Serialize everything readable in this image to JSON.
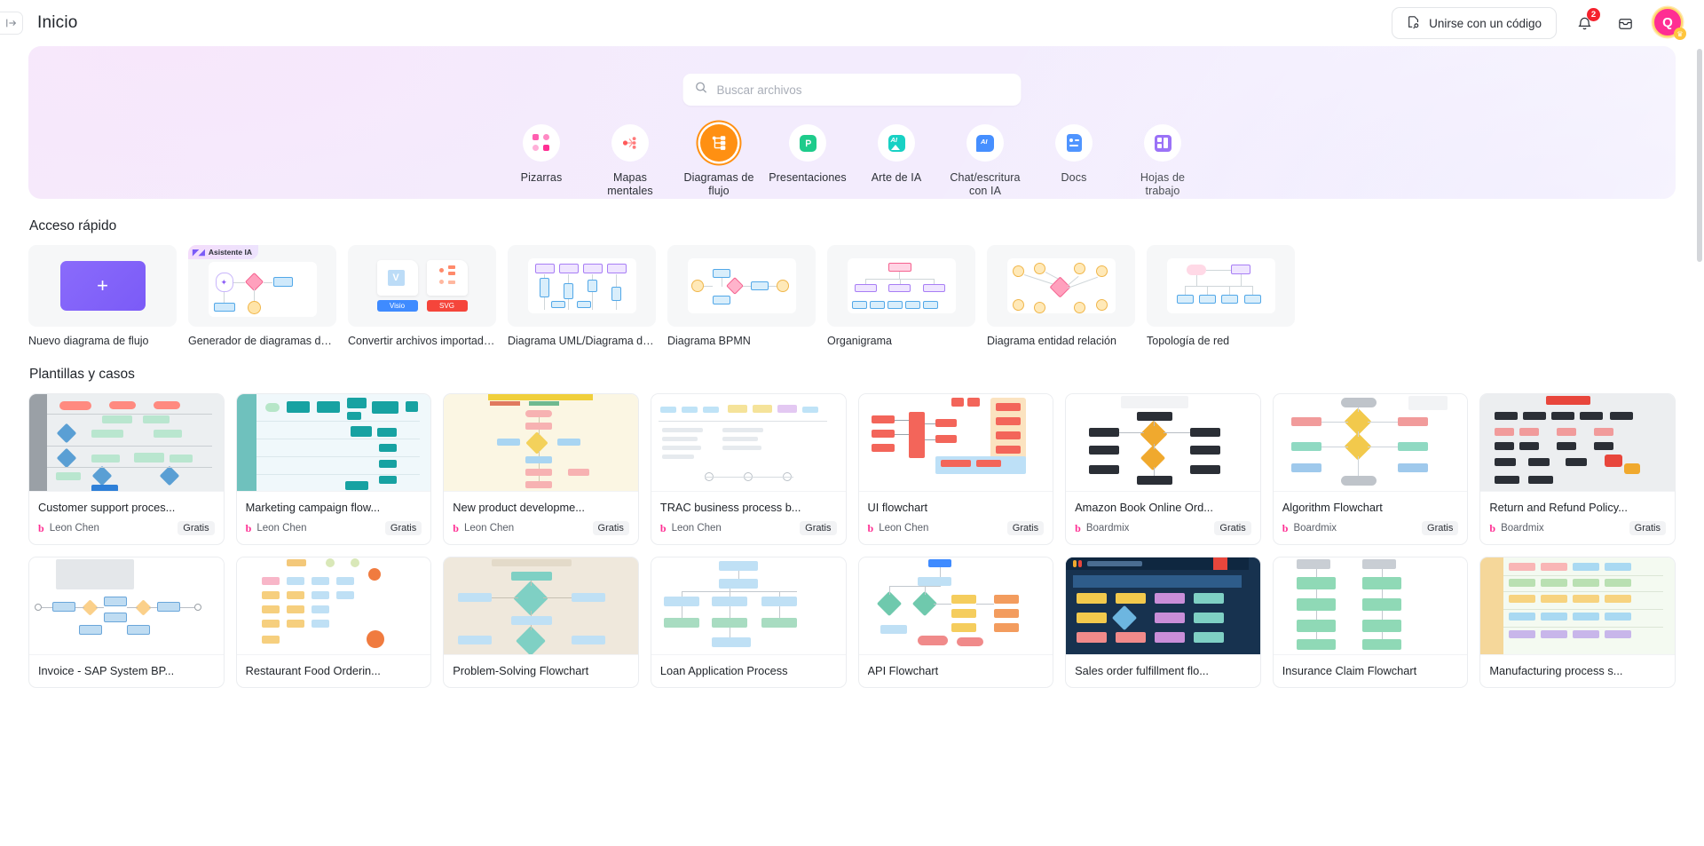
{
  "topbar": {
    "collapse_icon": "panel-collapse-icon",
    "title": "Inicio",
    "join_button": "Unirse con un código",
    "join_icon": "join-code-icon",
    "bell_icon": "bell-icon",
    "bell_badge": "2",
    "inbox_icon": "inbox-icon",
    "avatar_initial": "Q",
    "avatar_crown_icon": "crown-icon"
  },
  "hero": {
    "search": {
      "placeholder": "Buscar archivos",
      "value": "",
      "icon": "search-icon"
    },
    "categories": [
      {
        "label": "Pizarras",
        "icon": "whiteboard-icon",
        "active": false
      },
      {
        "label": "Mapas mentales",
        "icon": "mindmap-icon",
        "active": false
      },
      {
        "label": "Diagramas de flujo",
        "icon": "flowchart-icon",
        "active": true
      },
      {
        "label": "Presentaciones",
        "icon": "presentation-icon",
        "active": false
      },
      {
        "label": "Arte de IA",
        "icon": "ai-art-icon",
        "active": false
      },
      {
        "label": "Chat/escritura con IA",
        "icon": "ai-chat-icon",
        "active": false
      },
      {
        "label": "Docs",
        "icon": "docs-icon",
        "active": false
      },
      {
        "label": "Hojas de trabajo",
        "icon": "worksheet-icon",
        "active": false
      }
    ]
  },
  "quick_access": {
    "title": "Acceso rápido",
    "items": [
      {
        "label": "Nuevo diagrama de flujo",
        "thumb": "new-flowchart",
        "badge": ""
      },
      {
        "label": "Generador de diagramas de flujo ...",
        "thumb": "ai-generator",
        "badge": "Asistente IA"
      },
      {
        "label": "Convertir archivos importados en ...",
        "thumb": "import-convert",
        "badge": ""
      },
      {
        "label": "Diagrama UML/Diagrama de secu...",
        "thumb": "uml",
        "badge": ""
      },
      {
        "label": "Diagrama BPMN",
        "thumb": "bpmn",
        "badge": ""
      },
      {
        "label": "Organigrama",
        "thumb": "org-chart",
        "badge": ""
      },
      {
        "label": "Diagrama entidad relación",
        "thumb": "erd",
        "badge": ""
      },
      {
        "label": "Topología de red",
        "thumb": "network",
        "badge": ""
      }
    ]
  },
  "templates": {
    "title": "Plantillas y casos",
    "free_label": "Gratis",
    "items": [
      {
        "name": "Customer support proces...",
        "author": "Leon Chen",
        "price": "Gratis",
        "thumb": "swimlane-gray"
      },
      {
        "name": "Marketing campaign flow...",
        "author": "Leon Chen",
        "price": "Gratis",
        "thumb": "swimlane-teal"
      },
      {
        "name": "New product developme...",
        "author": "Leon Chen",
        "price": "Gratis",
        "thumb": "yellow-flow"
      },
      {
        "name": "TRAC business process b...",
        "author": "Leon Chen",
        "price": "Gratis",
        "thumb": "trac-lanes"
      },
      {
        "name": "UI flowchart",
        "author": "Leon Chen",
        "price": "Gratis",
        "thumb": "ui-flow-red"
      },
      {
        "name": "Amazon Book Online Ord...",
        "author": "Boardmix",
        "price": "Gratis",
        "thumb": "amazon-dark"
      },
      {
        "name": "Algorithm Flowchart",
        "author": "Boardmix",
        "price": "Gratis",
        "thumb": "algorithm"
      },
      {
        "name": "Return and Refund Policy...",
        "author": "Boardmix",
        "price": "Gratis",
        "thumb": "return-refund"
      },
      {
        "name": "Invoice - SAP System BP...",
        "author": "",
        "price": "",
        "thumb": "invoice-sap"
      },
      {
        "name": "Restaurant Food Orderin...",
        "author": "",
        "price": "",
        "thumb": "restaurant"
      },
      {
        "name": "Problem-Solving Flowchart",
        "author": "",
        "price": "",
        "thumb": "problem-solving"
      },
      {
        "name": "Loan Application Process",
        "author": "",
        "price": "",
        "thumb": "loan"
      },
      {
        "name": "API Flowchart",
        "author": "",
        "price": "",
        "thumb": "api"
      },
      {
        "name": "Sales order fulfillment flo...",
        "author": "",
        "price": "",
        "thumb": "sales-order"
      },
      {
        "name": "Insurance Claim Flowchart",
        "author": "",
        "price": "",
        "thumb": "insurance"
      },
      {
        "name": "Manufacturing process s...",
        "author": "",
        "price": "",
        "thumb": "manufacturing"
      }
    ]
  },
  "colors": {
    "accent": "#ff9012",
    "brand_pink": "#ff2e93",
    "purple": "#7b5bf7",
    "badge_red": "#f5222d"
  }
}
